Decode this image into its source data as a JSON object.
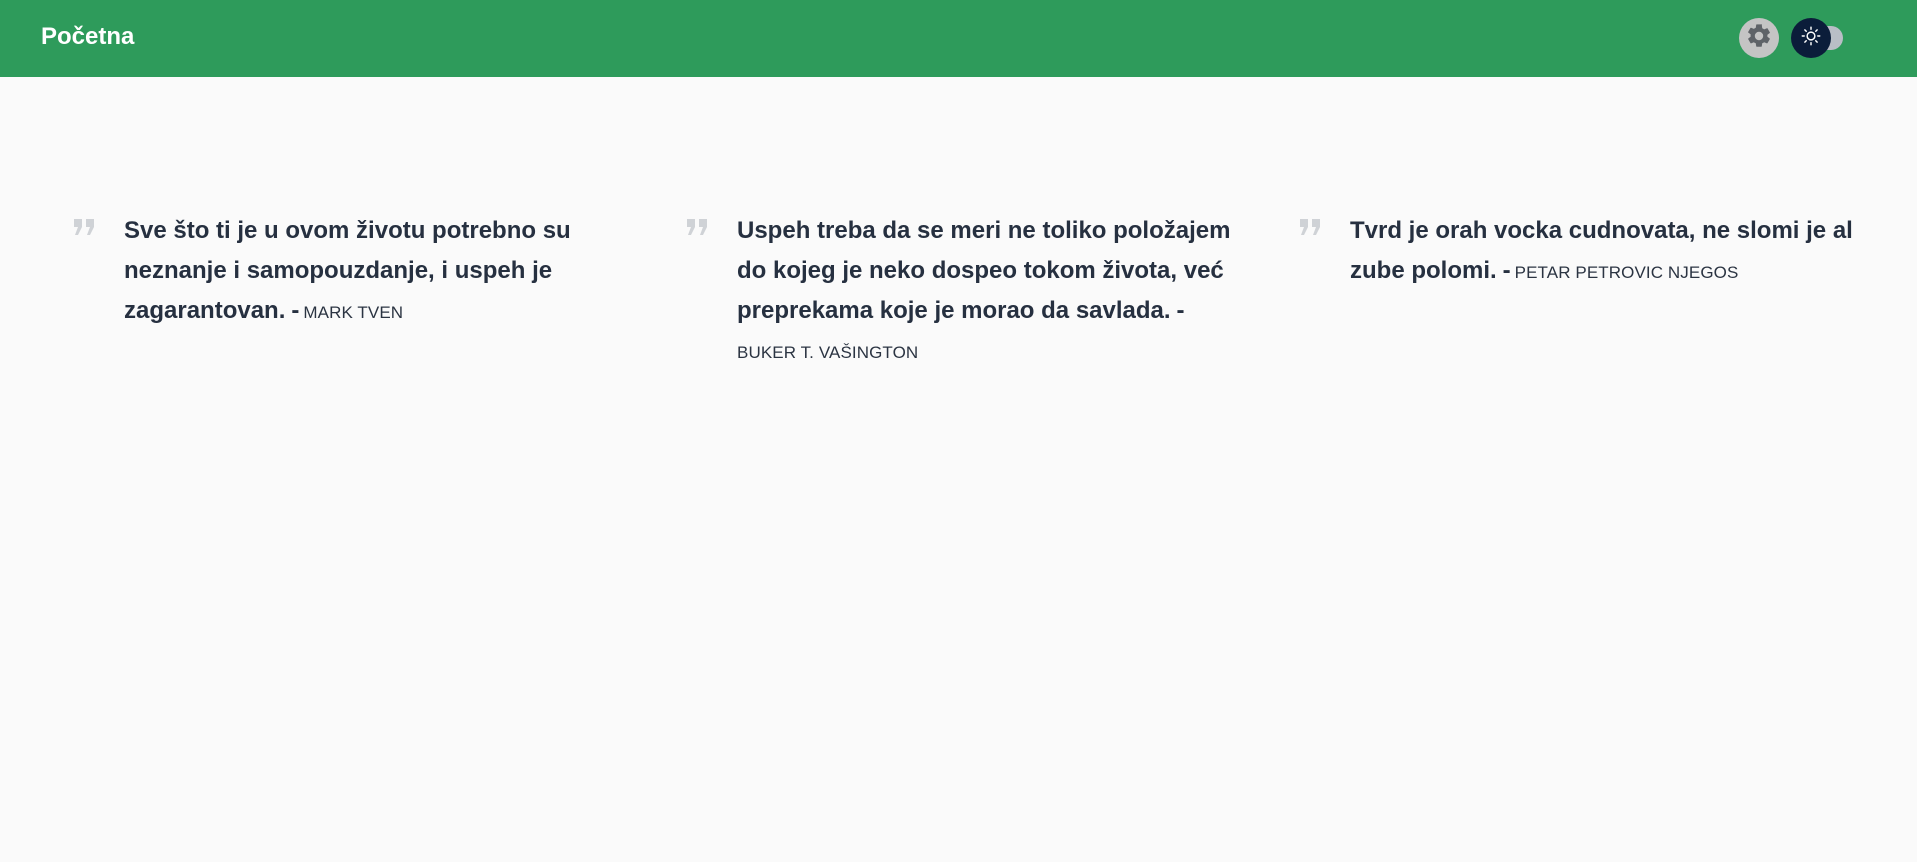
{
  "header": {
    "title": "Početna",
    "settings_icon": "gear-icon",
    "theme_icon": "sun-icon",
    "colors": {
      "bar": "#2e9b5b",
      "toggle_thumb": "#0b1d3a",
      "toggle_track": "#b9bec6",
      "settings_bg": "#c4c4c4"
    }
  },
  "quotes": [
    {
      "text": "Sve što ti je u ovom životu potrebno su neznanje i samopouzdanje, i uspeh je zagarantovan.",
      "dash": "-",
      "author": "MARK TVEN"
    },
    {
      "text": "Uspeh treba da se meri ne toliko položajem do kojeg je neko dospeo tokom života, već preprekama koje je morao da savlada.",
      "dash": "-",
      "author": "BUKER T. VAŠINGTON"
    },
    {
      "text": "Tvrd je orah vocka cudnovata, ne slomi je al zube polomi.",
      "dash": "-",
      "author": "PETAR PETROVIC NJEGOS"
    }
  ]
}
